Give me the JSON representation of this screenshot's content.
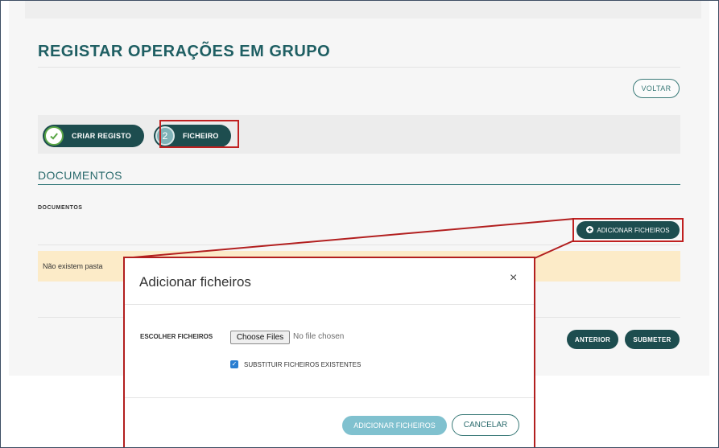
{
  "page": {
    "title": "REGISTAR OPERAÇÕES EM GRUPO",
    "back_label": "VOLTAR"
  },
  "steps": [
    {
      "label": "CRIAR REGISTO",
      "icon": "check-icon",
      "status": "done"
    },
    {
      "label": "FICHEIRO",
      "number": "2",
      "status": "active"
    }
  ],
  "documents": {
    "heading": "DOCUMENTOS",
    "label": "DOCUMENTOS",
    "add_files_label": "ADICIONAR FICHEIROS",
    "empty_message": "Não existem pasta"
  },
  "footer": {
    "previous_label": "ANTERIOR",
    "submit_label": "SUBMETER"
  },
  "modal": {
    "title": "Adicionar ficheiros",
    "close_symbol": "×",
    "choose_label": "ESCOLHER FICHEIROS",
    "choose_button": "Choose Files",
    "file_status": "No file chosen",
    "replace_label": "SUBSTITUIR FICHEIROS EXISTENTES",
    "replace_checked": true,
    "add_button": "ADICIONAR FICHEIROS",
    "cancel_button": "CANCELAR"
  },
  "colors": {
    "primary": "#1d4d4f",
    "title": "#1f5f63",
    "highlight": "#c02020",
    "alert_bg": "#fcebc8",
    "modal_add": "#80c1cf",
    "checkbox": "#2a7ed1"
  }
}
